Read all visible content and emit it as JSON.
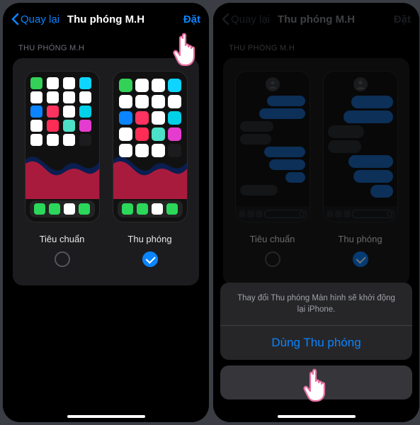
{
  "left": {
    "nav": {
      "back": "Quay lại",
      "title": "Thu phóng M.H",
      "action": "Đặt"
    },
    "section_label": "THU PHÓNG M.H",
    "options": {
      "standard_label": "Tiêu chuẩn",
      "zoomed_label": "Thu phóng"
    },
    "app_colors_rows": [
      [
        "#33d158",
        "#ffffff",
        "#ffffff",
        "#0ed5ff"
      ],
      [
        "#ffffff",
        "#ffffff",
        "#ffffff",
        "#ffffff"
      ],
      [
        "#0a84ff",
        "#ff3260",
        "#ffffff",
        "#00d0e8"
      ],
      [
        "#ffffff",
        "#ff2d55",
        "#4be0c7",
        "#e53cd0"
      ],
      [
        "#ffffff",
        "#ffffff",
        "#ffffff",
        "#1c1c1e"
      ]
    ],
    "dock_colors": [
      "#2bd85a",
      "#2bd85a",
      "#ffffff",
      "#2bd85a"
    ],
    "wave_color_a": "#0a1e50",
    "wave_color_b": "#c61b3a"
  },
  "right": {
    "nav": {
      "back": "Quay lại",
      "title": "Thu phóng M.H",
      "action": "Đặt"
    },
    "section_label": "THU PHÓNG M.H",
    "options": {
      "standard_label": "Tiêu chuẩn",
      "zoomed_label": "Thu phóng"
    },
    "sheet": {
      "message": "Thay đổi Thu phóng Màn hình sẽ khởi động lại iPhone.",
      "confirm": "Dùng Thu phóng"
    }
  }
}
